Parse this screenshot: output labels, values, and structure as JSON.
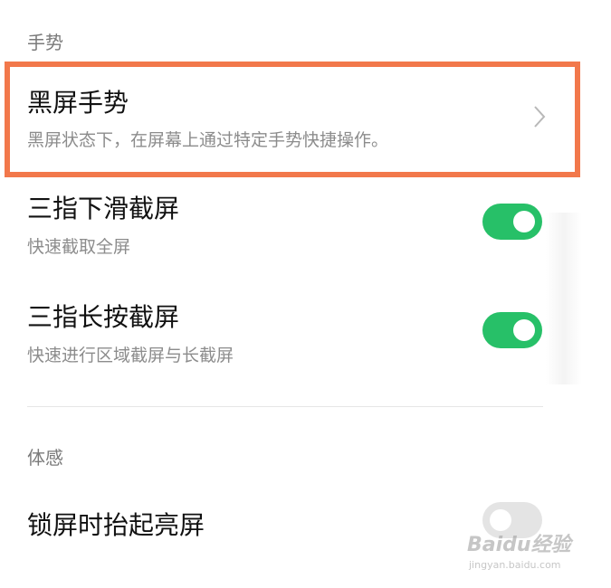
{
  "sections": {
    "gesture_header": "手势",
    "motion_header": "体感"
  },
  "rows": {
    "black_screen": {
      "title": "黑屏手势",
      "subtitle": "黑屏状态下，在屏幕上通过特定手势快捷操作。"
    },
    "three_finger_swipe": {
      "title": "三指下滑截屏",
      "subtitle": "快速截取全屏",
      "toggle": "on"
    },
    "three_finger_press": {
      "title": "三指长按截屏",
      "subtitle": "快速进行区域截屏与长截屏",
      "toggle": "on"
    },
    "raise_to_wake": {
      "title": "锁屏时抬起亮屏",
      "toggle": "off"
    }
  },
  "watermark": {
    "logo": "Baidu经验",
    "url": "jingyan.baidu.com"
  },
  "colors": {
    "toggle_on": "#27c068",
    "highlight_border": "#f2784b"
  },
  "icons": {
    "chevron": "chevron-right-icon"
  }
}
